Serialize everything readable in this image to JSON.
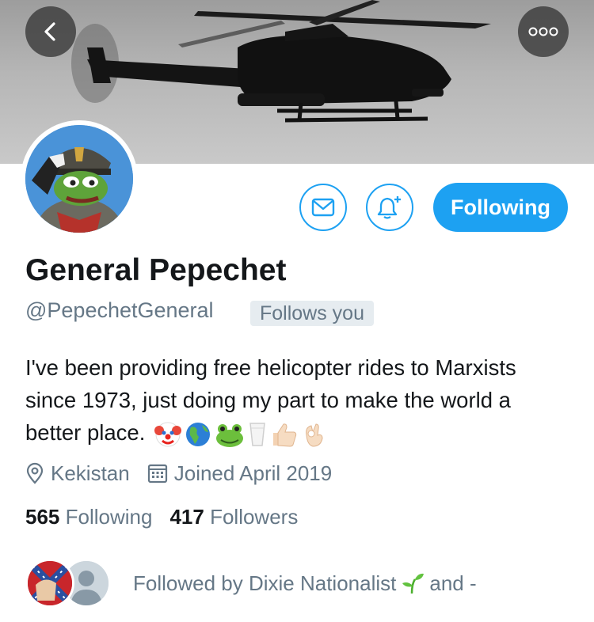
{
  "header": {
    "back_icon": "chevron-left-icon",
    "more_icon": "more-horizontal-icon"
  },
  "profile": {
    "name": "General Pepechet",
    "handle": "@PepechetGeneral",
    "follows_you_badge": "Follows you",
    "bio": "I've been providing free helicopter rides to Marxists since 1973, just doing my part to make the world a better place.",
    "bio_emojis": [
      "clown-face",
      "globe-americas",
      "frog-face",
      "glass-of-milk",
      "thumbs-up",
      "ok-hand"
    ],
    "location": "Kekistan",
    "joined": "Joined April 2019",
    "following_count": "565",
    "following_label": "Following",
    "followers_count": "417",
    "followers_label": "Followers"
  },
  "actions": {
    "follow_button_label": "Following",
    "message_icon": "envelope-icon",
    "notification_icon": "bell-plus-icon"
  },
  "followed_by": {
    "text": "Followed by Dixie Nationalist",
    "suffix": "and -"
  },
  "colors": {
    "accent": "#1da1f2",
    "secondary_text": "#657786",
    "primary_text": "#14171a",
    "badge_bg": "#e6ecf0"
  }
}
